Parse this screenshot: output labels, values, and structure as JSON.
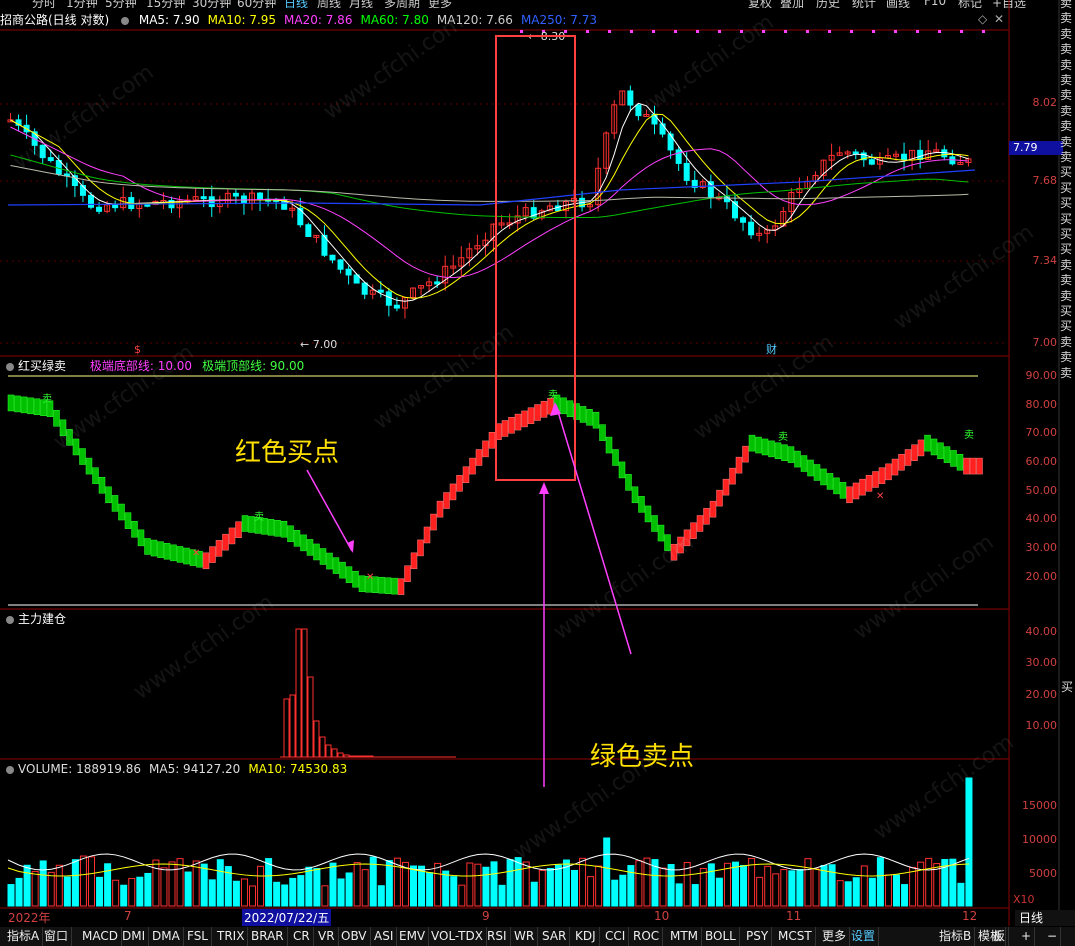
{
  "toolbar": {
    "left_items": [
      "分时",
      "1分钟",
      "5分钟",
      "15分钟",
      "30分钟",
      "60分钟",
      "日线",
      "周线",
      "月线",
      "多周期",
      "更多"
    ],
    "active_item": "日线",
    "right_items": [
      "复权",
      "叠加",
      "历史",
      "统计",
      "画线",
      "F10",
      "标记",
      "+自选"
    ]
  },
  "main_panel": {
    "stock_name": "招商公路(日线 对数)",
    "ma_labels": [
      {
        "text": "MA5: 7.90",
        "color": "#ffffff"
      },
      {
        "text": "MA10: 7.95",
        "color": "#ffff00"
      },
      {
        "text": "MA20: 7.86",
        "color": "#ff40ff"
      },
      {
        "text": "MA60: 7.80",
        "color": "#00ff00"
      },
      {
        "text": "MA120: 7.66",
        "color": "#cccccc"
      },
      {
        "text": "MA250: 7.73",
        "color": "#3060ff"
      }
    ],
    "y_ticks": [
      "8.02",
      "7.68",
      "7.34",
      "7.00"
    ],
    "current_price": "7.79",
    "high_label": "8.30",
    "low_label": "7.00",
    "markers": [
      "$",
      "财"
    ]
  },
  "indicator1": {
    "name": "红买绿卖",
    "params": [
      {
        "text": "极端底部线: 10.00",
        "color": "#ff40ff"
      },
      {
        "text": "极端顶部线: 90.00",
        "color": "#40ff40"
      }
    ],
    "y_ticks": [
      "90.00",
      "80.00",
      "70.00",
      "60.00",
      "50.00",
      "40.00",
      "30.00",
      "20.00"
    ],
    "sell_mark": "卖",
    "buy_mark": "✕"
  },
  "indicator2": {
    "name": "主力建仓",
    "y_ticks": [
      "40.00",
      "30.00",
      "20.00",
      "10.00"
    ]
  },
  "volume_panel": {
    "labels": [
      {
        "text": "VOLUME: 188919.86",
        "color": "#dddddd"
      },
      {
        "text": "MA5: 94127.20",
        "color": "#dddddd"
      },
      {
        "text": "MA10: 74530.83",
        "color": "#ffff00"
      }
    ],
    "y_ticks": [
      "15000",
      "10000",
      "5000"
    ],
    "unit": "X10"
  },
  "side_labels": {
    "text": "卖卖卖卖卖卖卖卖卖卖卖买买买买买买卖卖卖买买卖卖卖",
    "vol_side": "买"
  },
  "annotations": {
    "red_buy": "红色买点",
    "green_sell": "绿色卖点"
  },
  "date_axis": {
    "labels": [
      "2022年",
      "7",
      "2022/07/22/五",
      "9",
      "10",
      "11",
      "12"
    ],
    "period": "日线"
  },
  "bottom_tabs": [
    "指标A",
    "窗口",
    "MACD",
    "DMI",
    "DMA",
    "FSL",
    "TRIX",
    "BRAR",
    "CR",
    "VR",
    "OBV",
    "ASI",
    "EMV",
    "VOL-TDX",
    "RSI",
    "WR",
    "SAR",
    "KDJ",
    "CCI",
    "ROC",
    "MTM",
    "BOLL",
    "PSY",
    "MCST",
    "更多",
    "设置"
  ],
  "bottom_right_tabs": [
    "指标B",
    "模板",
    "板"
  ],
  "watermark": "www.cfchi.com",
  "colors": {
    "up": "#ff3030",
    "down": "#00ffff",
    "grid": "#8b0000",
    "annotation": "#ffe000",
    "arrow": "#ff40ff",
    "box": "#ff4040"
  }
}
